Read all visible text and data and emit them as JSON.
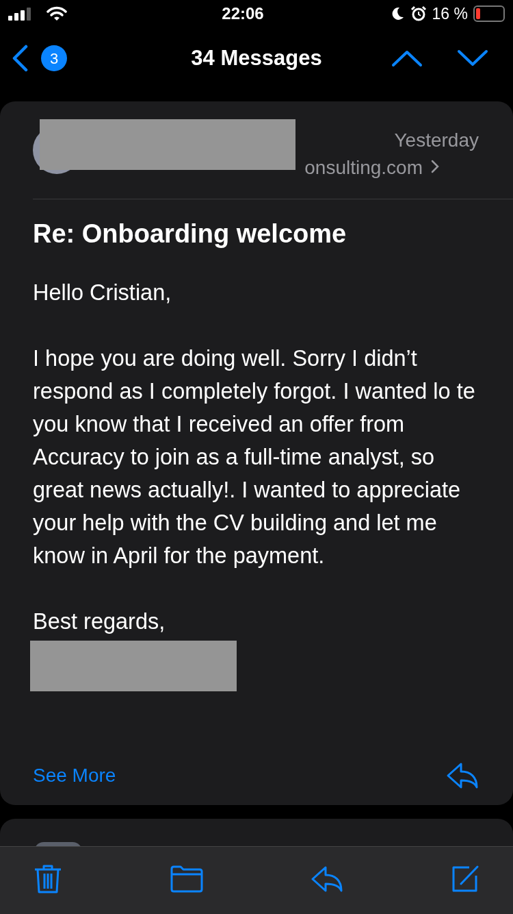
{
  "status_bar": {
    "time": "22:06",
    "battery_percent": "16 %",
    "battery": {
      "level": 0.16
    }
  },
  "nav": {
    "back_count": "3",
    "title": "34 Messages"
  },
  "message": {
    "date": "Yesterday",
    "recipient_visible": "onsulting.com",
    "subject": "Re: Onboarding welcome",
    "body": [
      "Hello Cristian,",
      "I hope you are doing well. Sorry I didn’t respond as I completely forgot. I wanted lo te you know that I received an offer from Accuracy to join as a full-time analyst, so great news actually!. I wanted to appreciate your help with the CV building and let me know in April for the payment.",
      "Best regards,"
    ],
    "see_more": "See More"
  }
}
